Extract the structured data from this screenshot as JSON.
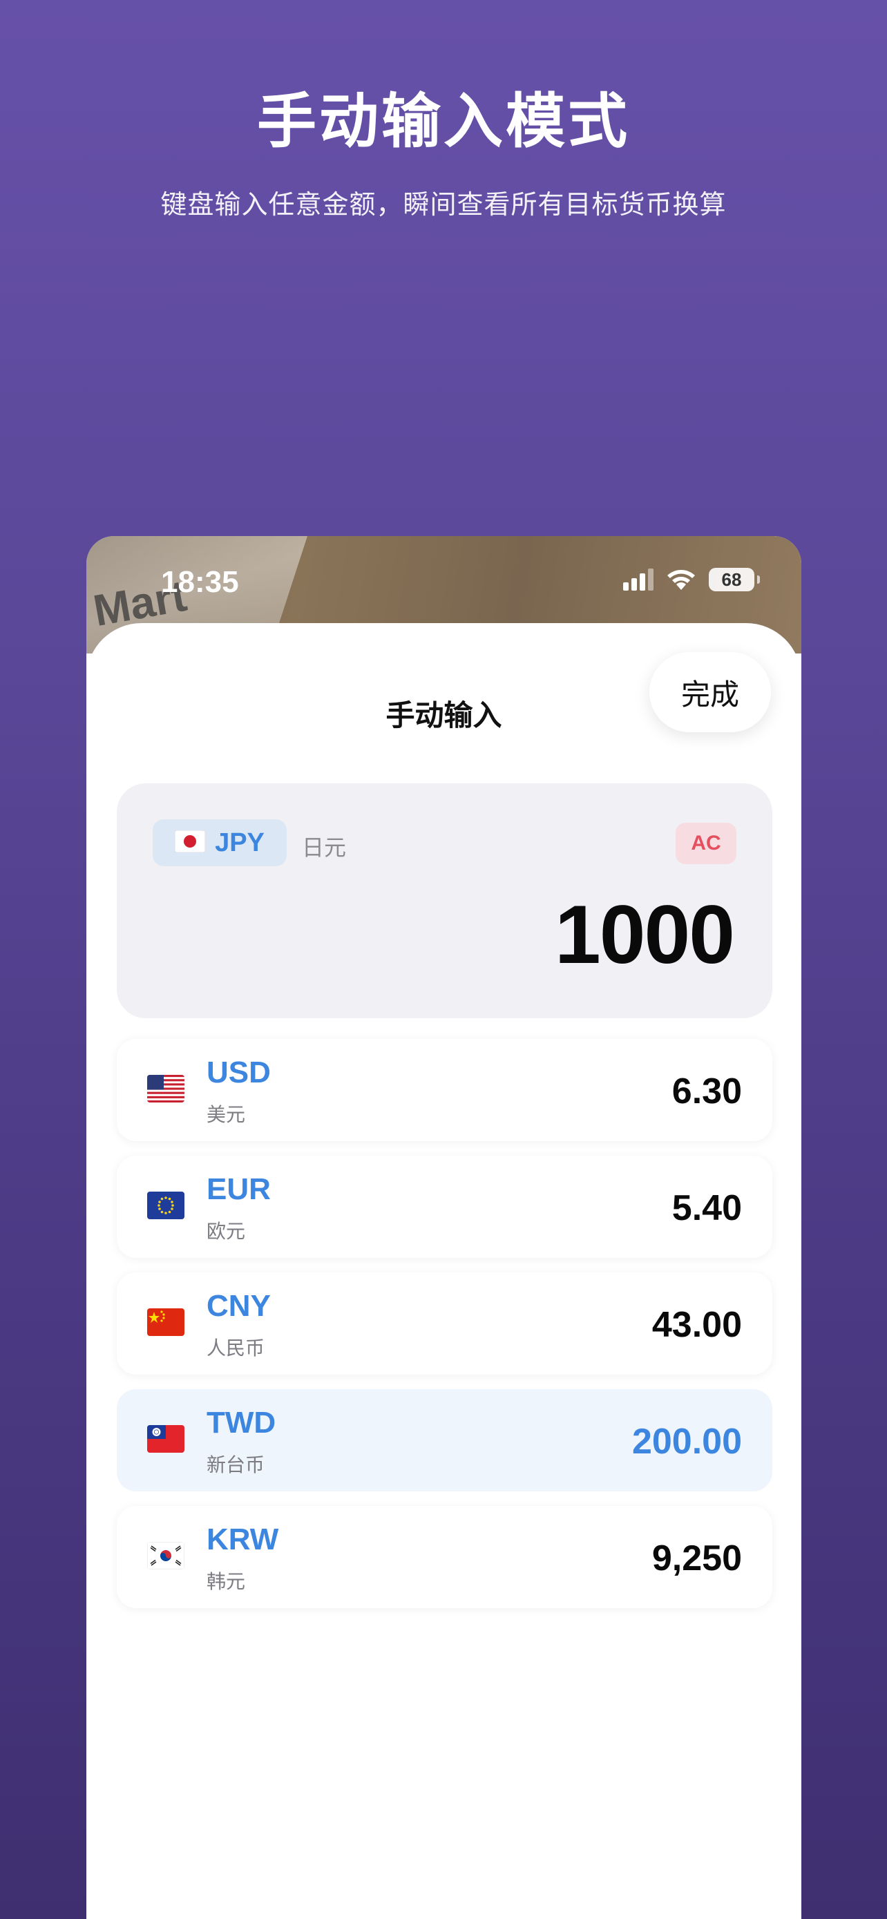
{
  "hero": {
    "title": "手动输入模式",
    "subtitle": "键盘输入任意金额，瞬间查看所有目标货币换算"
  },
  "status_bar": {
    "time": "18:35",
    "battery": "68"
  },
  "camera_preview": {
    "visible_text": "Mart"
  },
  "sheet": {
    "title": "手动输入",
    "done_label": "完成"
  },
  "input": {
    "base_code": "JPY",
    "base_name": "日元",
    "base_flag": "japan-flag-icon",
    "clear_label": "AC",
    "amount": "1000"
  },
  "results": [
    {
      "code": "USD",
      "name": "美元",
      "value": "6.30",
      "flag": "usa-flag-icon",
      "highlighted": false
    },
    {
      "code": "EUR",
      "name": "欧元",
      "value": "5.40",
      "flag": "eu-flag-icon",
      "highlighted": false
    },
    {
      "code": "CNY",
      "name": "人民币",
      "value": "43.00",
      "flag": "china-flag-icon",
      "highlighted": false
    },
    {
      "code": "TWD",
      "name": "新台币",
      "value": "200.00",
      "flag": "taiwan-flag-icon",
      "highlighted": true
    },
    {
      "code": "KRW",
      "name": "韩元",
      "value": "9,250",
      "flag": "korea-flag-icon",
      "highlighted": false
    }
  ],
  "colors": {
    "accent_blue": "#3d86df",
    "clear_red": "#e4505f",
    "background_purple": "#5a4797"
  }
}
